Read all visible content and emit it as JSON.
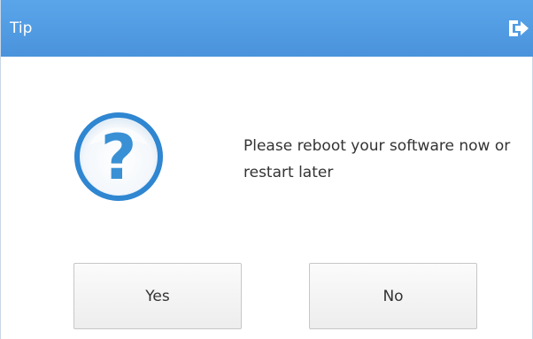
{
  "dialog": {
    "title": "Tip",
    "message": "Please reboot your software now or restart later",
    "icons": {
      "title_action": "exit-icon",
      "message": "question-icon"
    },
    "buttons": {
      "yes_label": "Yes",
      "no_label": "No"
    },
    "colors": {
      "title_bar": "#4a93dc",
      "title_text": "#ffffff",
      "icon_blue": "#2f86d1"
    }
  }
}
